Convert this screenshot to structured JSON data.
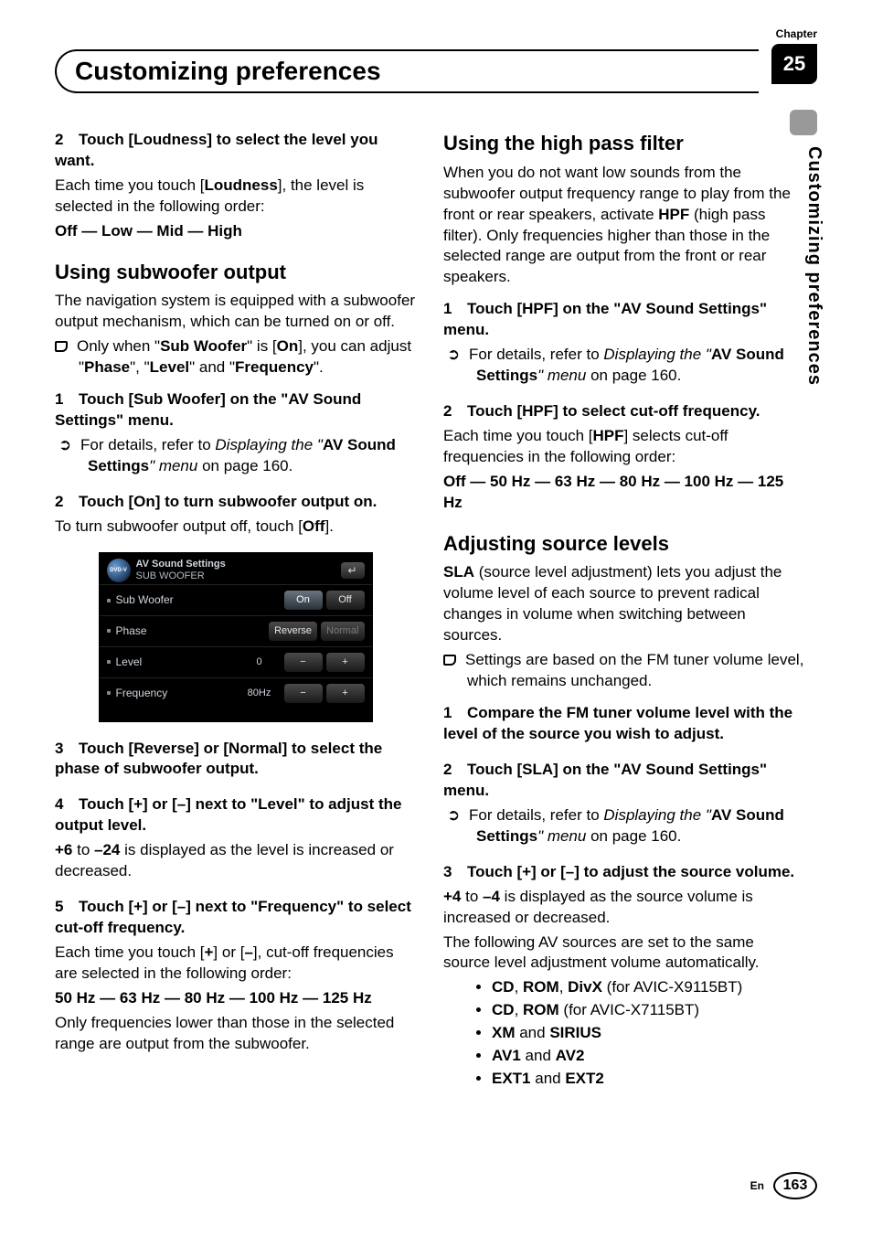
{
  "meta": {
    "chapter_label": "Chapter",
    "chapter_num": "25",
    "title": "Customizing preferences",
    "side_title": "Customizing preferences",
    "lang": "En",
    "page_num": "163"
  },
  "left": {
    "s2_head_a": "2",
    "s2_head_b": "Touch [Loudness] to select the level you want.",
    "s2_p1a": "Each time you touch [",
    "s2_p1b": "Loudness",
    "s2_p1c": "], the level is selected in the following order:",
    "s2_order": "Off — Low — Mid — High",
    "sub_h": "Using subwoofer output",
    "sub_p1": "The navigation system is equipped with a subwoofer output mechanism, which can be turned on or off.",
    "sub_bul_a": "Only when \"",
    "sub_bul_b": "Sub Woofer",
    "sub_bul_c": "\" is [",
    "sub_bul_d": "On",
    "sub_bul_e": "], you can adjust \"",
    "sub_bul_f": "Phase",
    "sub_bul_g": "\", \"",
    "sub_bul_h": "Level",
    "sub_bul_i": "\" and \"",
    "sub_bul_j": "Frequency",
    "sub_bul_k": "\".",
    "sub1_num": "1",
    "sub1_head": "Touch [Sub Woofer] on the \"AV Sound Settings\" menu.",
    "ref_a": "For details, refer to ",
    "ref_b": "Displaying the ",
    "ref_c": "\"",
    "ref_d": "AV Sound Settings",
    "ref_e": "\" menu",
    "ref_f": " on page 160.",
    "sub2_num": "2",
    "sub2_head": "Touch [On] to turn subwoofer output on.",
    "sub2_p_a": "To turn subwoofer output off, touch [",
    "sub2_p_b": "Off",
    "sub2_p_c": "].",
    "shot": {
      "logo": "DVD-V",
      "t1": "AV Sound Settings",
      "t2": "SUB WOOFER",
      "r1": {
        "label": "Sub Woofer",
        "a": "On",
        "b": "Off"
      },
      "r2": {
        "label": "Phase",
        "a": "Reverse",
        "b": "Normal"
      },
      "r3": {
        "label": "Level",
        "val": "0",
        "a": "−",
        "b": "+"
      },
      "r4": {
        "label": "Frequency",
        "val": "80Hz",
        "a": "−",
        "b": "+"
      }
    },
    "sub3_num": "3",
    "sub3_head": "Touch [Reverse] or [Normal] to select the phase of subwoofer output.",
    "sub4_num": "4",
    "sub4_head": "Touch [+] or [–] next to \"Level\" to adjust the output level.",
    "sub4_p_a": "+6",
    "sub4_p_b": " to ",
    "sub4_p_c": "–24",
    "sub4_p_d": " is displayed as the level is increased or decreased.",
    "sub5_num": "5",
    "sub5_head": "Touch [+] or [–] next to \"Frequency\" to select cut-off frequency.",
    "sub5_p1_a": "Each time you touch [",
    "sub5_p1_b": "+",
    "sub5_p1_c": "] or [",
    "sub5_p1_d": "–",
    "sub5_p1_e": "], cut-off frequencies are selected in the following order:",
    "sub5_order": "50 Hz — 63 Hz — 80 Hz — 100 Hz — 125 Hz",
    "sub5_p2": "Only frequencies lower than those in the selected range are output from the subwoofer."
  },
  "right": {
    "hpf_h": "Using the high pass filter",
    "hpf_p1_a": "When you do not want low sounds from the subwoofer output frequency range to play from the front or rear speakers, activate ",
    "hpf_p1_b": "HPF",
    "hpf_p1_c": " (high pass filter). Only frequencies higher than those in the selected range are output from the front or rear speakers.",
    "hpf1_num": "1",
    "hpf1_head": "Touch [HPF] on the \"AV Sound Settings\" menu.",
    "hpf2_num": "2",
    "hpf2_head": "Touch [HPF] to select cut-off frequency.",
    "hpf2_p_a": "Each time you touch [",
    "hpf2_p_b": "HPF",
    "hpf2_p_c": "] selects cut-off frequencies in the following order:",
    "hpf2_order": "Off — 50 Hz — 63 Hz — 80 Hz — 100 Hz — 125 Hz",
    "sla_h": "Adjusting source levels",
    "sla_p1_a": "SLA",
    "sla_p1_b": " (source level adjustment) lets you adjust the volume level of each source to prevent radical changes in volume when switching between sources.",
    "sla_bul": "Settings are based on the FM tuner volume level, which remains unchanged.",
    "sla1_num": "1",
    "sla1_head": "Compare the FM tuner volume level with the level of the source you wish to adjust.",
    "sla2_num": "2",
    "sla2_head": "Touch [SLA] on the \"AV Sound Settings\" menu.",
    "sla3_num": "3",
    "sla3_head": "Touch [+] or [–] to adjust the source volume.",
    "sla3_p_a": "+4",
    "sla3_p_b": " to ",
    "sla3_p_c": "–4",
    "sla3_p_d": " is displayed as the source volume is increased or decreased.",
    "sla3_p2": "The following AV sources are set to the same source level adjustment volume automatically.",
    "b1_a": "CD",
    "b1_b": ", ",
    "b1_c": "ROM",
    "b1_d": ", ",
    "b1_e": "DivX",
    "b1_f": " (for AVIC-X9115BT)",
    "b2_a": "CD",
    "b2_b": ", ",
    "b2_c": "ROM",
    "b2_d": " (for AVIC-X7115BT)",
    "b3_a": "XM",
    "b3_b": " and ",
    "b3_c": "SIRIUS",
    "b4_a": "AV1",
    "b4_b": " and ",
    "b4_c": "AV2",
    "b5_a": "EXT1",
    "b5_b": " and ",
    "b5_c": "EXT2"
  }
}
